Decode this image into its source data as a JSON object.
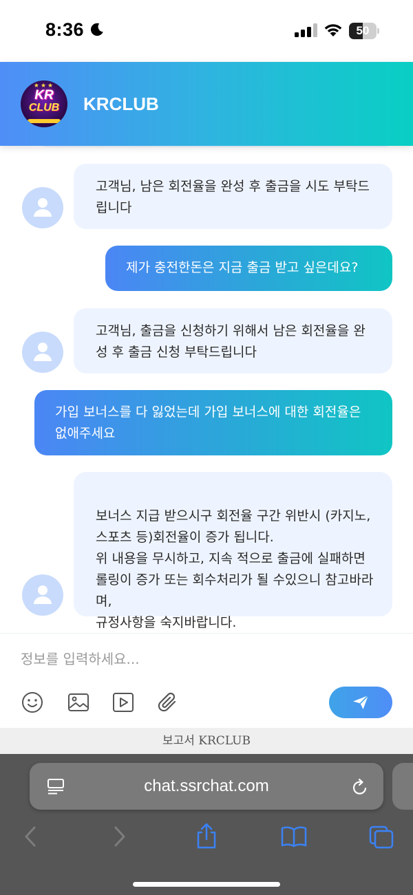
{
  "status_bar": {
    "time": "8:36",
    "battery_level": "50",
    "battery_fraction": 0.5,
    "icons": [
      "moon-icon",
      "signal-icon",
      "wifi-icon",
      "battery-icon"
    ]
  },
  "chat_header": {
    "logo_text_top": "KR",
    "logo_text_bottom": "CLUB",
    "title": "KRCLUB"
  },
  "messages": [
    {
      "sender": "agent",
      "text": "고객님, 남은 회전율을 완성 후 출금을 시도 부탁드립니다"
    },
    {
      "sender": "user",
      "text": "제가 충전한돈은 지금 출금 받고 싶은데요?"
    },
    {
      "sender": "agent",
      "text": "고객님, 출금을 신청하기 위해서 남은 회전율을 완성 후 출금 신청 부탁드립니다"
    },
    {
      "sender": "user",
      "text": "가입 보너스를 다 잃었는데 가입 보너스에 대한 회전율은 없애주세요"
    },
    {
      "sender": "agent",
      "text": "보너스 지급 받으시구 회전율 구간 위반시 (카지노, 스포츠 등)회전율이 증가 됩니다.\n위 내용을 무시하고, 지속 적으로 출금에 실패하면 롤링이 증가 또는 회수처리가 될 수있으니 참고바라며,\n규정사항을 숙지바랍니다."
    }
  ],
  "composer": {
    "placeholder": "정보를 입력하세요...",
    "value": "",
    "tools": [
      "emoji-icon",
      "image-icon",
      "video-icon",
      "attachment-icon"
    ],
    "send_icon": "send-icon"
  },
  "footer": {
    "credit": "보고서 KRCLUB"
  },
  "browser": {
    "url": "chat.ssrchat.com",
    "icons": [
      "reader-icon",
      "reload-icon",
      "back-icon",
      "forward-icon",
      "share-icon",
      "bookmarks-icon",
      "tabs-icon"
    ]
  },
  "colors": {
    "header_gradient_start": "#4f8ef7",
    "header_gradient_end": "#09cfc4",
    "agent_bubble": "#eef4ff",
    "avatar": "#c8dbfc",
    "browser_chrome": "#565656",
    "ios_blue": "#3b82f6"
  }
}
